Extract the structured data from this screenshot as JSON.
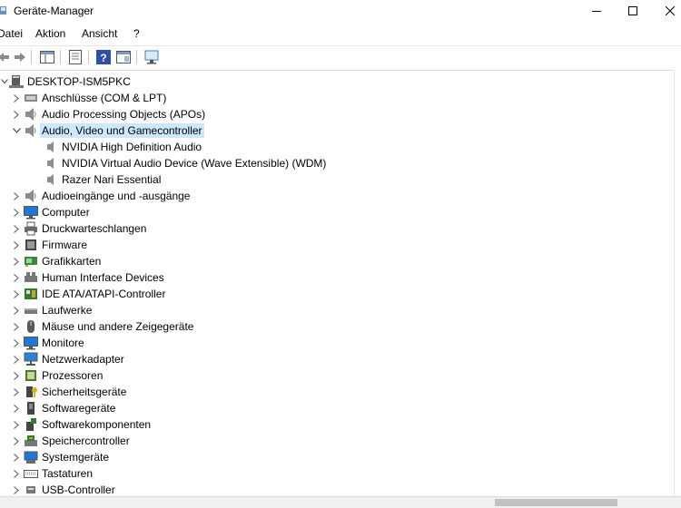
{
  "window": {
    "title": "Geräte-Manager"
  },
  "menu": [
    "Datei",
    "Aktion",
    "Ansicht",
    "?"
  ],
  "tree": {
    "root": "DESKTOP-ISM5PKC",
    "categories": [
      {
        "label": "Anschlüsse (COM & LPT)",
        "icon": "port-icon"
      },
      {
        "label": "Audio Processing Objects (APOs)",
        "icon": "speaker-icon"
      },
      {
        "label": "Audio, Video und Gamecontroller",
        "icon": "speaker-icon",
        "expanded": true,
        "children": [
          "NVIDIA High Definition Audio",
          "NVIDIA Virtual Audio Device (Wave Extensible) (WDM)",
          "Razer Nari Essential"
        ]
      },
      {
        "label": "Audioeingänge und -ausgänge",
        "icon": "speaker-icon"
      },
      {
        "label": "Computer",
        "icon": "monitor-icon"
      },
      {
        "label": "Druckwarteschlangen",
        "icon": "printer-icon"
      },
      {
        "label": "Firmware",
        "icon": "firmware-icon"
      },
      {
        "label": "Grafikkarten",
        "icon": "display-adapter-icon"
      },
      {
        "label": "Human Interface Devices",
        "icon": "hid-icon"
      },
      {
        "label": "IDE ATA/ATAPI-Controller",
        "icon": "ide-controller-icon"
      },
      {
        "label": "Laufwerke",
        "icon": "drive-icon"
      },
      {
        "label": "Mäuse und andere Zeigegeräte",
        "icon": "mouse-icon"
      },
      {
        "label": "Monitore",
        "icon": "monitor-icon"
      },
      {
        "label": "Netzwerkadapter",
        "icon": "network-icon"
      },
      {
        "label": "Prozessoren",
        "icon": "processor-icon"
      },
      {
        "label": "Sicherheitsgeräte",
        "icon": "security-key-icon"
      },
      {
        "label": "Softwaregeräte",
        "icon": "software-device-icon"
      },
      {
        "label": "Softwarekomponenten",
        "icon": "software-component-icon"
      },
      {
        "label": "Speichercontroller",
        "icon": "storage-controller-icon"
      },
      {
        "label": "Systemgeräte",
        "icon": "system-device-icon"
      },
      {
        "label": "Tastaturen",
        "icon": "keyboard-icon"
      },
      {
        "label": "USB-Controller",
        "icon": "usb-icon"
      }
    ]
  }
}
